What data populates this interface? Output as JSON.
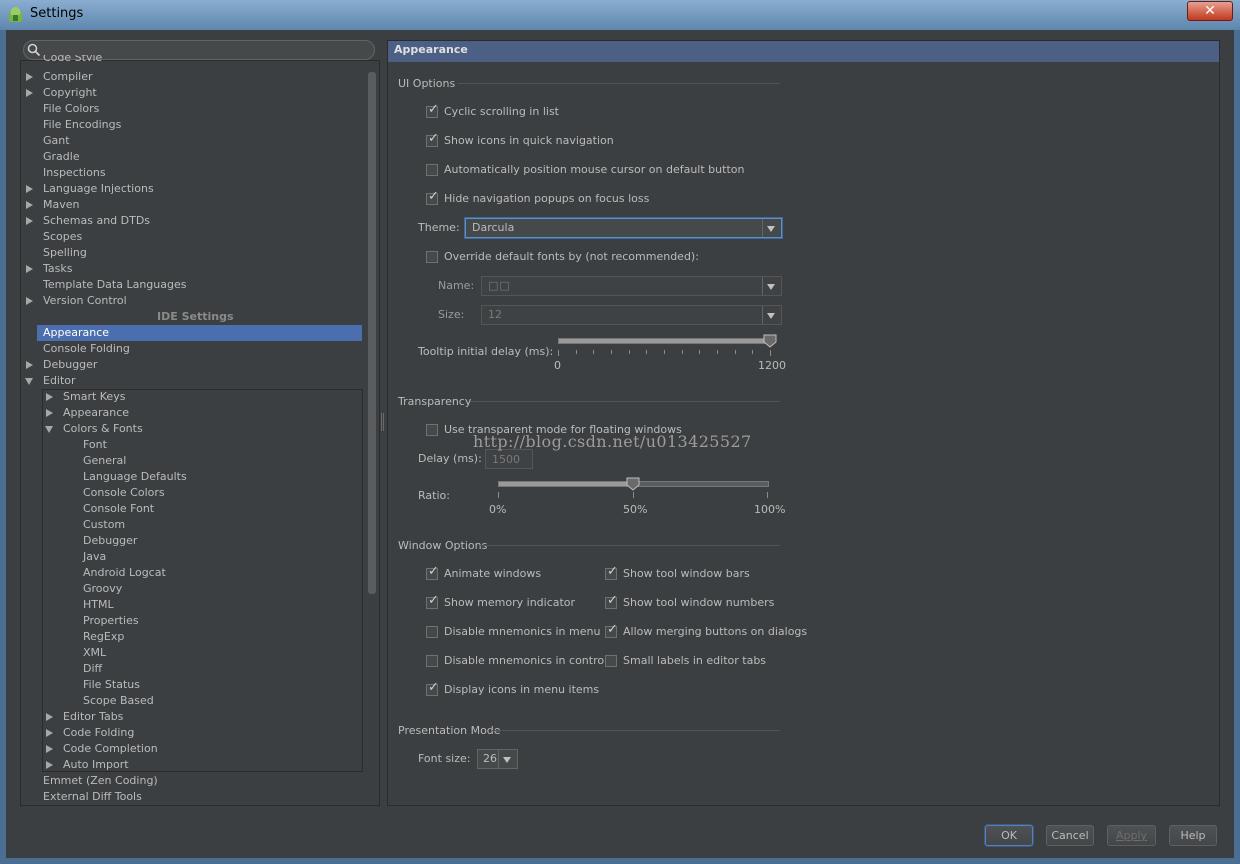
{
  "window": {
    "title": "Settings",
    "close_symbol": "✕"
  },
  "search": {
    "placeholder": ""
  },
  "tree": {
    "clipped_item": "Code Style",
    "project_items": [
      {
        "label": "Compiler",
        "expandable": true
      },
      {
        "label": "Copyright",
        "expandable": true
      },
      {
        "label": "File Colors",
        "expandable": false
      },
      {
        "label": "File Encodings",
        "expandable": false
      },
      {
        "label": "Gant",
        "expandable": false
      },
      {
        "label": "Gradle",
        "expandable": false
      },
      {
        "label": "Inspections",
        "expandable": false
      },
      {
        "label": "Language Injections",
        "expandable": true
      },
      {
        "label": "Maven",
        "expandable": true
      },
      {
        "label": "Schemas and DTDs",
        "expandable": true
      },
      {
        "label": "Scopes",
        "expandable": false
      },
      {
        "label": "Spelling",
        "expandable": false
      },
      {
        "label": "Tasks",
        "expandable": true
      },
      {
        "label": "Template Data Languages",
        "expandable": false
      },
      {
        "label": "Version Control",
        "expandable": true
      }
    ],
    "ide_settings_header": "IDE Settings",
    "ide_items": [
      {
        "label": "Appearance",
        "selected": true
      },
      {
        "label": "Console Folding"
      },
      {
        "label": "Debugger",
        "expandable": true
      },
      {
        "label": "Editor",
        "expanded": true
      }
    ],
    "editor_children": [
      {
        "label": "Smart Keys",
        "expandable": true
      },
      {
        "label": "Appearance",
        "expandable": true
      },
      {
        "label": "Colors & Fonts",
        "expanded": true
      }
    ],
    "colors_fonts_children": [
      "Font",
      "General",
      "Language Defaults",
      "Console Colors",
      "Console Font",
      "Custom",
      "Debugger",
      "Java",
      "Android Logcat",
      "Groovy",
      "HTML",
      "Properties",
      "RegExp",
      "XML",
      "Diff",
      "File Status",
      "Scope Based"
    ],
    "editor_more": [
      "Editor Tabs",
      "Code Folding",
      "Code Completion",
      "Auto Import"
    ],
    "bottom_items": [
      "Emmet (Zen Coding)",
      "External Diff Tools"
    ]
  },
  "panel": {
    "title": "Appearance",
    "ui_options": {
      "title": "UI Options",
      "checks": [
        {
          "label": "Cyclic scrolling in list",
          "checked": true
        },
        {
          "label": "Show icons in quick navigation",
          "checked": true
        },
        {
          "label": "Automatically position mouse cursor on default button",
          "checked": false
        },
        {
          "label": "Hide navigation popups on focus loss",
          "checked": true
        }
      ],
      "theme_label": "Theme:",
      "theme_value": "Darcula",
      "override_label": "Override default fonts by (not recommended):",
      "override_checked": false,
      "name_label": "Name:",
      "name_value": "□□",
      "size_label": "Size:",
      "size_value": "12",
      "tooltip_label": "Tooltip initial delay (ms):",
      "tooltip_min": "0",
      "tooltip_max": "1200",
      "tooltip_fraction": 1.0
    },
    "transparency": {
      "title": "Transparency",
      "use_label": "Use transparent mode for floating windows",
      "use_checked": false,
      "delay_label": "Delay (ms):",
      "delay_value": "1500",
      "ratio_label": "Ratio:",
      "ratio_ticks": [
        "0%",
        "50%",
        "100%"
      ],
      "ratio_fraction": 0.5
    },
    "window_options": {
      "title": "Window Options",
      "left": [
        {
          "label": "Animate windows",
          "checked": true
        },
        {
          "label": "Show memory indicator",
          "checked": true
        },
        {
          "label": "Disable mnemonics in menu",
          "checked": false
        },
        {
          "label": "Disable mnemonics in controls",
          "checked": false
        },
        {
          "label": "Display icons in menu items",
          "checked": true
        }
      ],
      "right": [
        {
          "label": "Show tool window bars",
          "checked": true
        },
        {
          "label": "Show tool window numbers",
          "checked": true
        },
        {
          "label": "Allow merging buttons on dialogs",
          "checked": true
        },
        {
          "label": "Small labels in editor tabs",
          "checked": false
        }
      ]
    },
    "presentation": {
      "title": "Presentation Mode",
      "font_size_label": "Font size:",
      "font_size_value": "26"
    }
  },
  "watermark": "http://blog.csdn.net/u013425527",
  "buttons": {
    "ok": "OK",
    "cancel": "Cancel",
    "apply": "Apply",
    "help": "Help"
  }
}
